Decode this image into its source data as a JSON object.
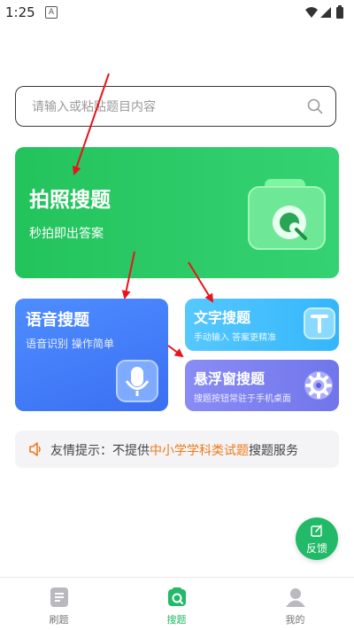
{
  "status_bar": {
    "time": "1:25",
    "notification_letter": "A"
  },
  "search": {
    "placeholder": "请输入或粘贴题目内容"
  },
  "cards": {
    "photo": {
      "title": "拍照搜题",
      "subtitle": "秒拍即出答案"
    },
    "voice": {
      "title": "语音搜题",
      "subtitle": "语音识别 操作简单"
    },
    "text": {
      "title": "文字搜题",
      "subtitle": "手动输入 答案更精准"
    },
    "float": {
      "title": "悬浮窗搜题",
      "subtitle": "搜题按钮常驻于手机桌面"
    }
  },
  "tip": {
    "prefix": "友情提示：不提供",
    "highlight": "中小学学科类试题",
    "suffix": "搜题服务"
  },
  "feedback": {
    "label": "反馈"
  },
  "tabs": [
    {
      "label": "刷题",
      "icon": "document-icon",
      "active": false
    },
    {
      "label": "搜题",
      "icon": "search-scan-icon",
      "active": true
    },
    {
      "label": "我的",
      "icon": "person-icon",
      "active": false
    }
  ],
  "colors": {
    "accent": "#22b968",
    "photo_card": "#2cc866",
    "voice_card": "#4680fa",
    "text_card": "#45befd",
    "float_card": "#7d80f0",
    "highlight": "#ef7a1a",
    "annotation_arrow": "#e8141b"
  }
}
